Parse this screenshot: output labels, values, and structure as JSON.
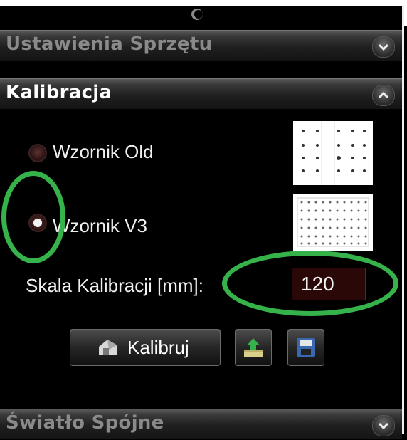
{
  "sections": {
    "hardware": {
      "title": "Ustawienia Sprzętu"
    },
    "calibration": {
      "title": "Kalibracja",
      "options": [
        {
          "label": "Wzornik Old",
          "checked": false
        },
        {
          "label": "Wzornik V3",
          "checked": true
        }
      ],
      "scale_label": "Skala Kalibracji [mm]:",
      "scale_value": "120",
      "calibrate_button": "Kalibruj"
    },
    "light": {
      "title": "Światło Spójne"
    }
  },
  "icons": [
    "collapse-grip-icon",
    "chevron-down-icon",
    "chevron-up-icon",
    "calibrate-icon",
    "upload-icon",
    "save-icon"
  ],
  "colors": {
    "highlight": "#36b24a",
    "input_bg": "#2b0808"
  }
}
